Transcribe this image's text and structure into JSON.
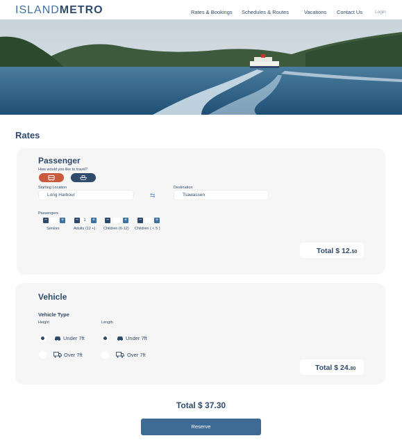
{
  "header": {
    "logo_part1": "ISLAND",
    "logo_part2": "METRO",
    "nav": [
      "Rates & Bookings",
      "Schedules & Routes",
      "Vacations",
      "Contact Us"
    ],
    "login": "Login"
  },
  "page": {
    "title": "Rates"
  },
  "passenger": {
    "title": "Passenger",
    "question": "How would you like to travel?",
    "modes": [
      {
        "icon": "bus-icon"
      },
      {
        "icon": "ferry-icon"
      }
    ],
    "start_label": "Starting Location",
    "start_value": "Long Harbour",
    "dest_label": "Destination",
    "dest_value": "Tsawassen",
    "passengers_label": "Passengers",
    "groups": [
      {
        "label": "Seniors",
        "count": ""
      },
      {
        "label": "Adults  (12 +)",
        "count": "1"
      },
      {
        "label": "Children (6-12)",
        "count": ""
      },
      {
        "label": "Children ( < 5 )",
        "count": ""
      }
    ],
    "total_prefix": "Total $ 12.",
    "total_cents": "50"
  },
  "vehicle": {
    "title": "Vehicle",
    "type_label": "Vehicle Type",
    "height_label": "Height",
    "length_label": "Length",
    "height_options": [
      {
        "label": "Under 7ft",
        "selected": true,
        "icon": "car-icon"
      },
      {
        "label": "Over 7ft",
        "selected": false,
        "icon": "truck-icon"
      }
    ],
    "length_options": [
      {
        "label": "Under 7ft",
        "selected": true,
        "icon": "car-icon"
      },
      {
        "label": "Over 7ft",
        "selected": false,
        "icon": "truck-icon"
      }
    ],
    "total_prefix": "Total $ 24.",
    "total_cents": "80"
  },
  "summary": {
    "total": "Total $ 37.30",
    "reserve_label": "Reserve"
  },
  "colors": {
    "primary": "#2f4a6b",
    "accent": "#3f72a0",
    "bus": "#c95a3e",
    "button": "#3d6b94"
  }
}
